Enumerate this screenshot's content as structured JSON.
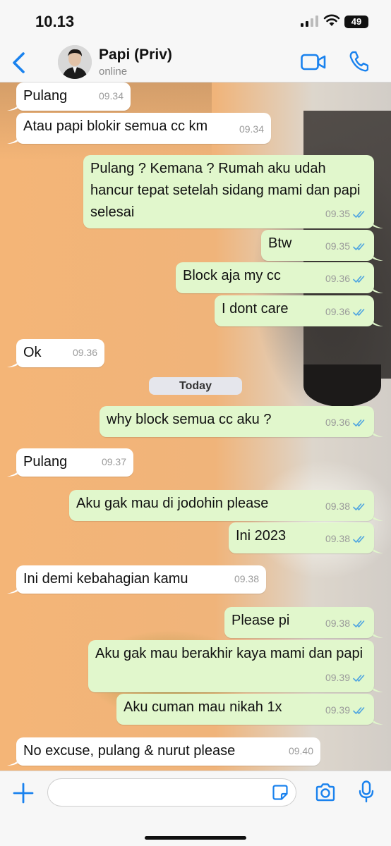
{
  "status_bar": {
    "time": "10.13",
    "battery": "49"
  },
  "header": {
    "contact_name": "Papi (Priv)",
    "status": "online"
  },
  "day_separator": "Today",
  "messages": [
    {
      "dir": "in",
      "text": "Pulang",
      "time": "09.34"
    },
    {
      "dir": "in",
      "text": "Atau papi blokir semua cc km",
      "time": "09.34"
    },
    {
      "dir": "out",
      "text": "Pulang ? Kemana ? Rumah aku udah hancur tepat setelah sidang mami dan papi selesai",
      "time": "09.35",
      "status": "read"
    },
    {
      "dir": "out",
      "text": "Btw",
      "time": "09.35",
      "status": "read"
    },
    {
      "dir": "out",
      "text": "Block aja my cc",
      "time": "09.36",
      "status": "read"
    },
    {
      "dir": "out",
      "text": "I dont care",
      "time": "09.36",
      "status": "read"
    },
    {
      "dir": "in",
      "text": "Ok",
      "time": "09.36"
    },
    {
      "dir": "out",
      "text": "why block semua cc aku ?",
      "time": "09.36",
      "status": "read"
    },
    {
      "dir": "in",
      "text": "Pulang",
      "time": "09.37"
    },
    {
      "dir": "out",
      "text": "Aku gak mau di jodohin please",
      "time": "09.38",
      "status": "read"
    },
    {
      "dir": "out",
      "text": "Ini 2023",
      "time": "09.38",
      "status": "read"
    },
    {
      "dir": "in",
      "text": "Ini demi kebahagian kamu",
      "time": "09.38"
    },
    {
      "dir": "out",
      "text": "Please pi",
      "time": "09.38",
      "status": "read"
    },
    {
      "dir": "out",
      "text": "Aku gak mau berakhir kaya mami dan papi",
      "time": "09.39",
      "status": "read"
    },
    {
      "dir": "out",
      "text": "Aku cuman mau nikah 1x",
      "time": "09.39",
      "status": "read"
    },
    {
      "dir": "in",
      "text": "No excuse, pulang & nurut please",
      "time": "09.40"
    }
  ],
  "composer": {
    "value": ""
  },
  "icons": {
    "back": "chevron-left-icon",
    "video": "video-camera-icon",
    "call": "phone-icon",
    "attach": "plus-icon",
    "sticker": "sticker-icon",
    "camera": "camera-icon",
    "mic": "microphone-icon",
    "read_receipt": "double-check-icon"
  },
  "colors": {
    "accent": "#1a82ee",
    "incoming_bubble": "#ffffff",
    "outgoing_bubble": "#e1f7cc",
    "read_tick": "#4fa5e0"
  }
}
